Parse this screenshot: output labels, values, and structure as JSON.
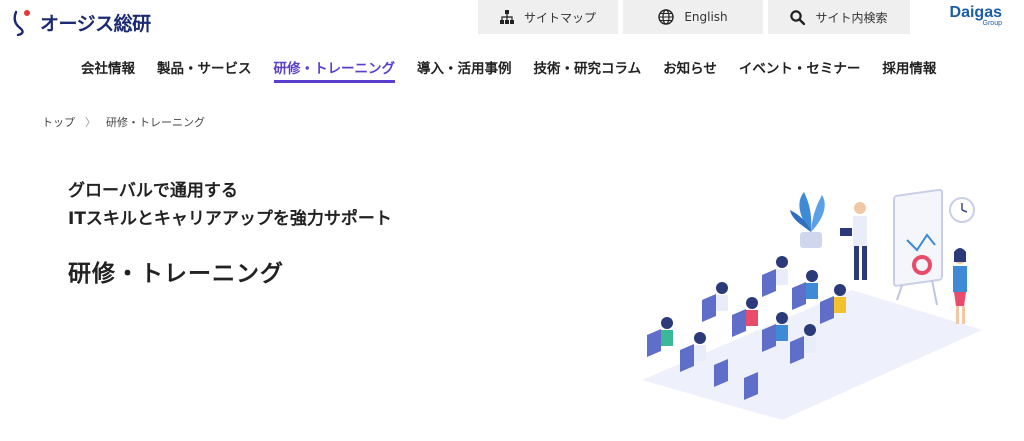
{
  "logo": {
    "text": "オージス総研"
  },
  "utility": {
    "sitemap": "サイトマップ",
    "english": "English",
    "search": "サイト内検索"
  },
  "daigas": {
    "name": "Daigas",
    "sub": "Group"
  },
  "nav": {
    "items": [
      "会社情報",
      "製品・サービス",
      "研修・トレーニング",
      "導入・活用事例",
      "技術・研究コラム",
      "お知らせ",
      "イベント・セミナー",
      "採用情報"
    ],
    "active_index": 2
  },
  "breadcrumb": {
    "home": "トップ",
    "current": "研修・トレーニング"
  },
  "hero": {
    "catch_line1": "グローバルで通用する",
    "catch_line2": "ITスキルとキャリアアップを強力サポート",
    "title": "研修・トレーニング"
  },
  "colors": {
    "accent": "#5a3fcf",
    "brand": "#1b2a73",
    "daigas": "#1a5ea8",
    "util_bg": "#efefef"
  }
}
